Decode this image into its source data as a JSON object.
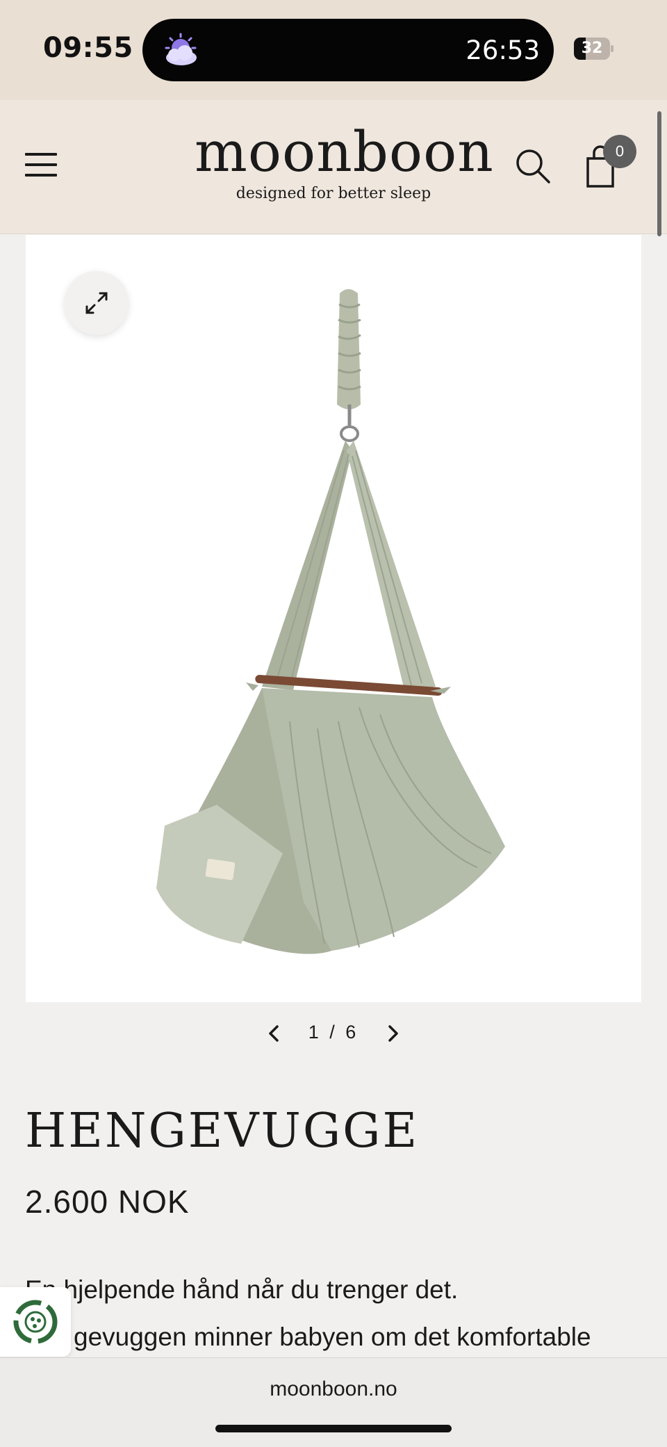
{
  "status_bar": {
    "time": "09:55",
    "live_activity_timer": "26:53",
    "battery_level": "32",
    "weather_icon": "moon-cloud-icon"
  },
  "header": {
    "logo": "moonboon",
    "tagline": "designed for better sleep",
    "cart_count": "0",
    "menu_icon": "hamburger-menu-icon",
    "search_icon": "search-icon",
    "cart_icon": "shopping-bag-icon"
  },
  "gallery": {
    "current_page": "1",
    "separator": "/",
    "total_pages": "6"
  },
  "product": {
    "title": "HENGEVUGGE",
    "price": "2.600 NOK",
    "description_lines": [
      "En hjelpende hånd når du trenger det.",
      "gevuggen minner babyen om det komfortable"
    ]
  },
  "browser": {
    "url": "moonboon.no"
  },
  "colors": {
    "status_bar_bg": "#eadfd3",
    "header_bg": "#efe7de",
    "page_bg": "#f2f0ee",
    "fabric_green": "#b4bcaa",
    "wood_bar": "#7a4a34",
    "eco_badge_green": "#2f6b3a"
  }
}
